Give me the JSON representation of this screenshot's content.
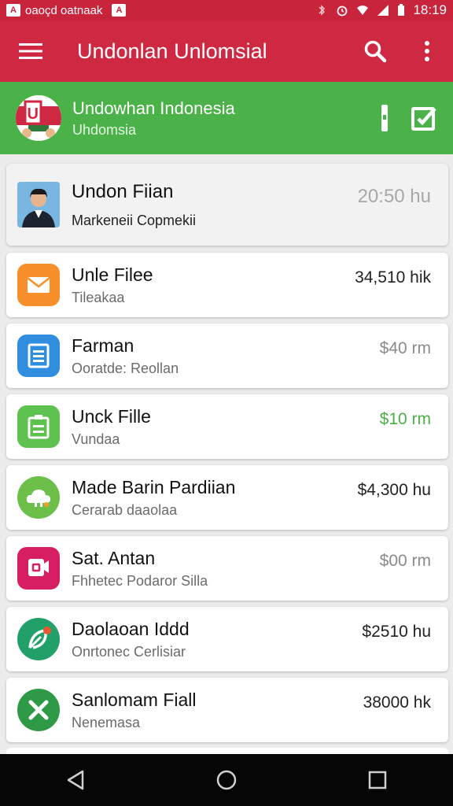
{
  "status_bar": {
    "notification_text": "oaoçd oatnaak",
    "time": "18:19",
    "icons": [
      "app-notification-icon",
      "alarm-icon",
      "wifi-icon",
      "signal-icon",
      "battery-icon"
    ]
  },
  "app_bar": {
    "title": "Undonlan Unlomsial",
    "icons": [
      "menu-icon",
      "search-icon",
      "more-vert-icon"
    ],
    "color": "#cf2843"
  },
  "header": {
    "title": "Undowhan Indonesia",
    "subtitle": "Uhdomsia",
    "logo_letter": "U",
    "color": "#4ab248",
    "icons": [
      "bookmark-icon",
      "edit-icon"
    ]
  },
  "items": [
    {
      "title": "Undon Fiian",
      "subtitle": "Markeneii Copmekii",
      "amount": "20:50 hu",
      "icon": "person-avatar"
    },
    {
      "title": "Unle Filee",
      "subtitle": "Tileakaa",
      "amount": "34,510 hik",
      "icon": "mail-icon",
      "icon_color": "#f7902b"
    },
    {
      "title": "Farman",
      "subtitle": "Ooratde: Reollan",
      "amount": "$40 rm",
      "icon": "document-icon",
      "icon_color": "#2f8fde"
    },
    {
      "title": "Unck Fille",
      "subtitle": "Vundaa",
      "amount": "$10 rm",
      "icon": "clipboard-icon",
      "icon_color": "#5dc24f"
    },
    {
      "title": "Made Barin Pardiian",
      "subtitle": "Cerarab daaolaa",
      "amount": "$4,300 hu",
      "icon": "cloud-icon",
      "icon_color": "#6cc04a"
    },
    {
      "title": "Sat. Antan",
      "subtitle": "Fhhetec Podaror Silla",
      "amount": "$00 rm",
      "icon": "message-icon",
      "icon_color": "#d81e63"
    },
    {
      "title": "Daolaoan Iddd",
      "subtitle": "Onrtonec Cerlisiar",
      "amount": "$2510 hu",
      "icon": "leaf-icon",
      "icon_color": "#22a06a"
    },
    {
      "title": "Sanlomam Fiall",
      "subtitle": "Nenemasa",
      "amount": "38000 hk",
      "icon": "close-x-icon",
      "icon_color": "#2e9a48"
    }
  ],
  "nav_bar": {
    "icons": [
      "back-icon",
      "home-icon",
      "recents-icon"
    ]
  }
}
